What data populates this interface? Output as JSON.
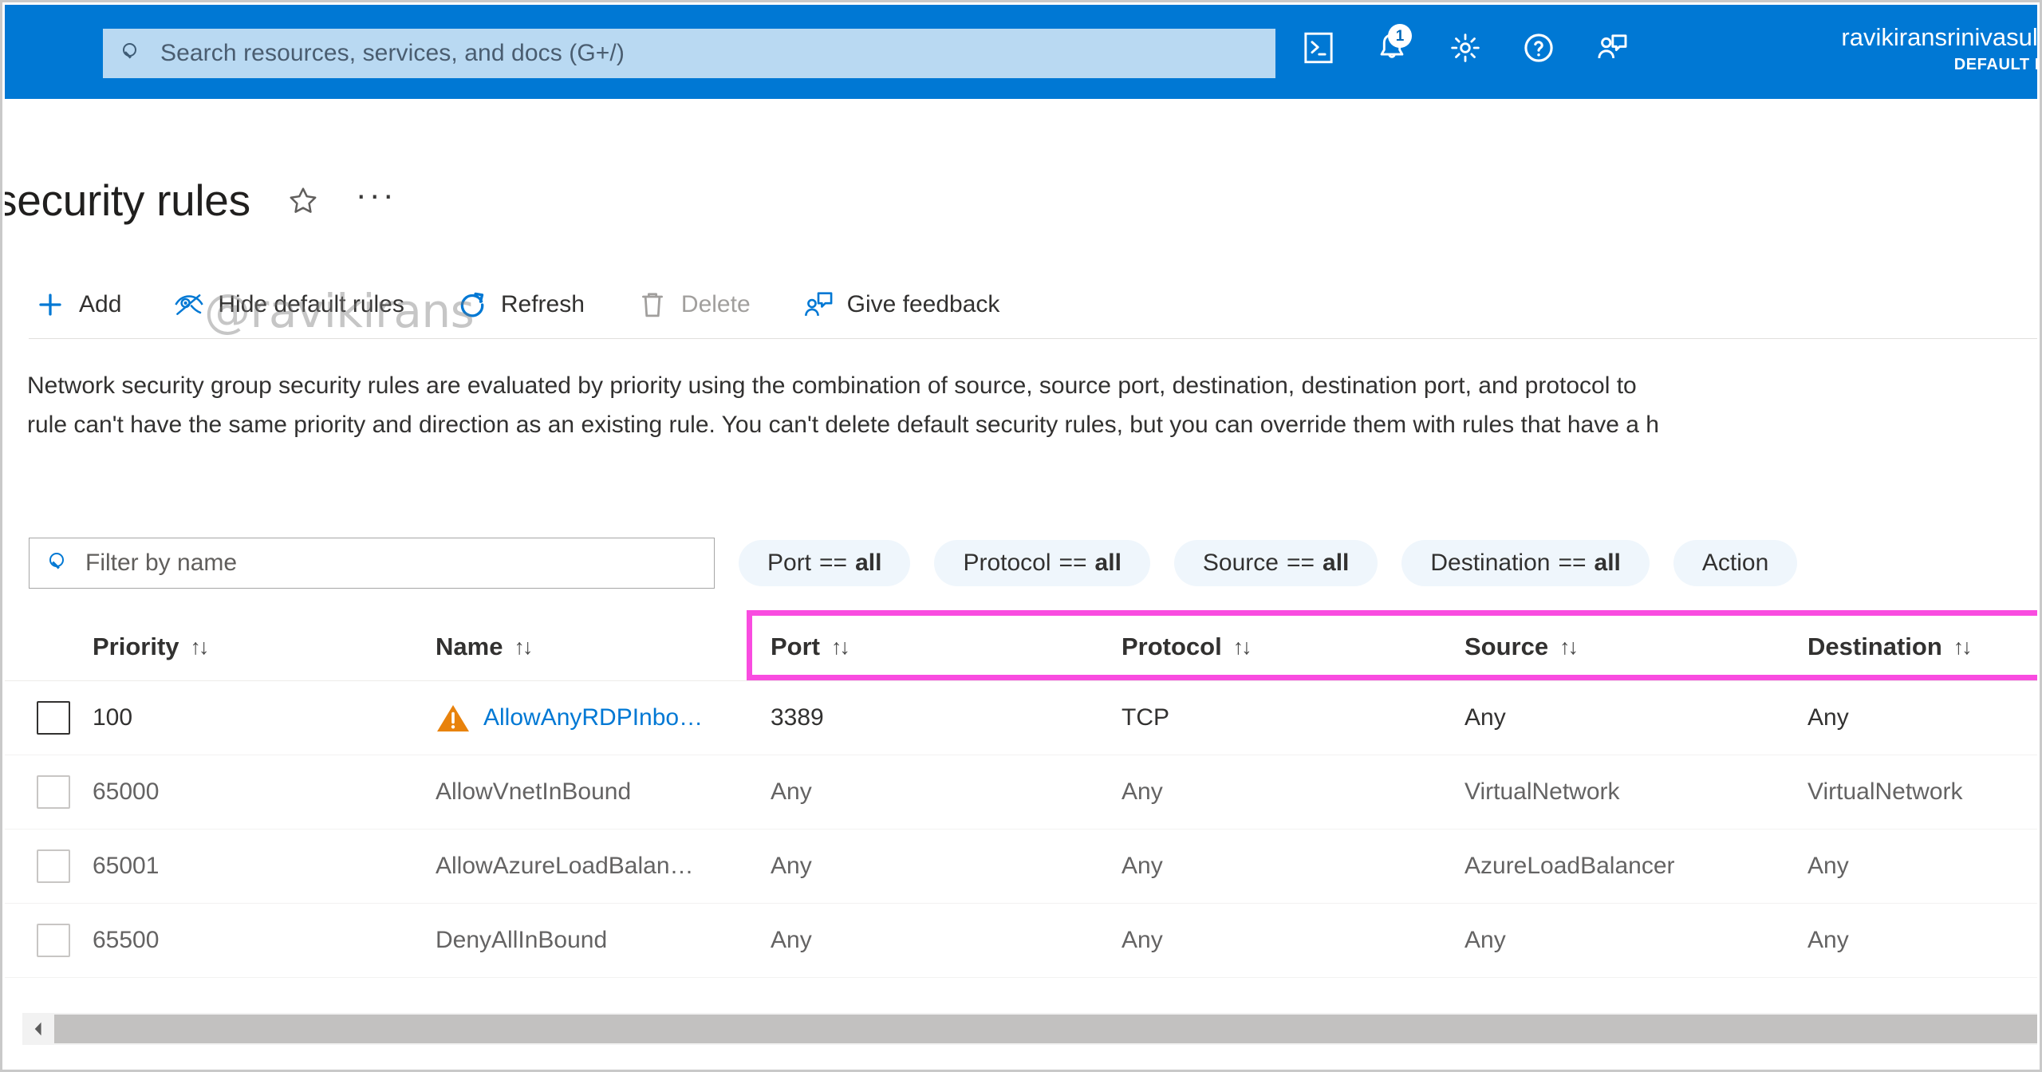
{
  "topbar": {
    "search": {
      "placeholder": "Search resources, services, and docs (G+/)",
      "value": "",
      "icon": "search-icon"
    },
    "icons": [
      {
        "name": "cloud-shell-icon",
        "label": "Cloud Shell"
      },
      {
        "name": "notifications-bell-icon",
        "label": "Notifications",
        "badge": "1"
      },
      {
        "name": "settings-gear-icon",
        "label": "Settings"
      },
      {
        "name": "help-question-icon",
        "label": "Help"
      },
      {
        "name": "feedback-person-icon",
        "label": "Feedback"
      }
    ],
    "account": {
      "name": "ravikiransrinivasulu",
      "directory": "DEFAULT DI"
    }
  },
  "header": {
    "title": "security rules",
    "favorite_icon": "star-icon",
    "more_icon": "ellipsis-icon"
  },
  "watermark": "@ravikirans",
  "toolbar": {
    "items": [
      {
        "label": "Add",
        "icon": "plus-icon",
        "disabled": false
      },
      {
        "label": "Hide default rules",
        "icon": "eye-hide-icon",
        "disabled": false
      },
      {
        "label": "Refresh",
        "icon": "refresh-icon",
        "disabled": false
      },
      {
        "label": "Delete",
        "icon": "trash-icon",
        "disabled": true
      },
      {
        "label": "Give feedback",
        "icon": "feedback-person-icon",
        "disabled": false
      }
    ]
  },
  "description": {
    "line1": "Network security group security rules are evaluated by priority using the combination of source, source port, destination, destination port, and protocol to",
    "line2": "rule can't have the same priority and direction as an existing rule. You can't delete default security rules, but you can override them with rules that have a h"
  },
  "filters": {
    "search": {
      "placeholder": "Filter by name",
      "value": "",
      "icon": "search-icon"
    },
    "pills": [
      {
        "field": "Port",
        "op": "==",
        "value": "all"
      },
      {
        "field": "Protocol",
        "op": "==",
        "value": "all"
      },
      {
        "field": "Source",
        "op": "==",
        "value": "all"
      },
      {
        "field": "Destination",
        "op": "==",
        "value": "all"
      },
      {
        "field": "Action",
        "op": "",
        "value": ""
      }
    ],
    "pill_truncated_label": "Action"
  },
  "table": {
    "columns": [
      {
        "key": "priority",
        "label": "Priority",
        "sortable": true
      },
      {
        "key": "name",
        "label": "Name",
        "sortable": true
      },
      {
        "key": "port",
        "label": "Port",
        "sortable": true
      },
      {
        "key": "protocol",
        "label": "Protocol",
        "sortable": true
      },
      {
        "key": "source",
        "label": "Source",
        "sortable": true
      },
      {
        "key": "destination",
        "label": "Destination",
        "sortable": true
      }
    ],
    "sort_glyph": "↑↓",
    "highlight_color": "#f94ce0",
    "rows": [
      {
        "checked": false,
        "priority": "100",
        "name": "AllowAnyRDPInbo…",
        "warning": true,
        "is_link": true,
        "port": "3389",
        "protocol": "TCP",
        "source": "Any",
        "destination": "Any",
        "muted": false
      },
      {
        "checked": false,
        "priority": "65000",
        "name": "AllowVnetInBound",
        "warning": false,
        "is_link": false,
        "port": "Any",
        "protocol": "Any",
        "source": "VirtualNetwork",
        "destination": "VirtualNetwork",
        "muted": true
      },
      {
        "checked": false,
        "priority": "65001",
        "name": "AllowAzureLoadBalan…",
        "warning": false,
        "is_link": false,
        "port": "Any",
        "protocol": "Any",
        "source": "AzureLoadBalancer",
        "destination": "Any",
        "muted": true
      },
      {
        "checked": false,
        "priority": "65500",
        "name": "DenyAllInBound",
        "warning": false,
        "is_link": false,
        "port": "Any",
        "protocol": "Any",
        "source": "Any",
        "destination": "Any",
        "muted": true
      }
    ]
  },
  "scrollbar": {
    "left_arrow_icon": "chevron-left-icon"
  },
  "colors": {
    "azure_blue": "#0078d4",
    "link_blue": "#0078d4",
    "warning_orange": "#e8820c",
    "highlight_magenta": "#f94ce0",
    "pill_bg": "#eff6fc"
  }
}
